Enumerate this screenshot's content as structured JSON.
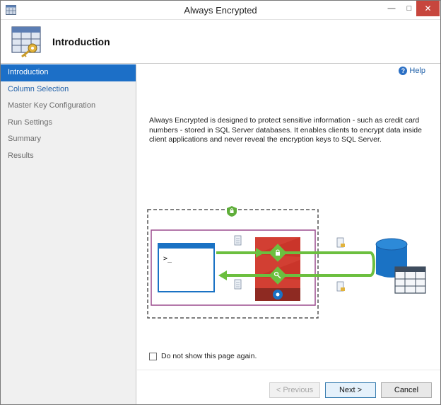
{
  "window": {
    "title": "Always Encrypted"
  },
  "header": {
    "title": "Introduction"
  },
  "sidebar": {
    "items": [
      {
        "label": "Introduction",
        "state": "active"
      },
      {
        "label": "Column Selection",
        "state": "link"
      },
      {
        "label": "Master Key Configuration",
        "state": "disabled"
      },
      {
        "label": "Run Settings",
        "state": "disabled"
      },
      {
        "label": "Summary",
        "state": "disabled"
      },
      {
        "label": "Results",
        "state": "disabled"
      }
    ]
  },
  "main": {
    "help_label": "Help",
    "description": "Always Encrypted is designed to protect sensitive information - such as credit card numbers - stored in SQL Server databases. It enables clients to encrypt data inside client applications and never reveal the encryption keys to SQL Server.",
    "checkbox_label": "Do not show this page again.",
    "checkbox_checked": false
  },
  "buttons": {
    "previous": "< Previous",
    "next": "Next >",
    "cancel": "Cancel"
  },
  "colors": {
    "accent": "#1c6fc7",
    "link": "#1e5fa8",
    "close": "#c7463d",
    "diagram_green": "#6cbf3f",
    "diagram_purple": "#9b4c8e",
    "diagram_red": "#d23f33",
    "diagram_blue": "#1a72c4"
  }
}
